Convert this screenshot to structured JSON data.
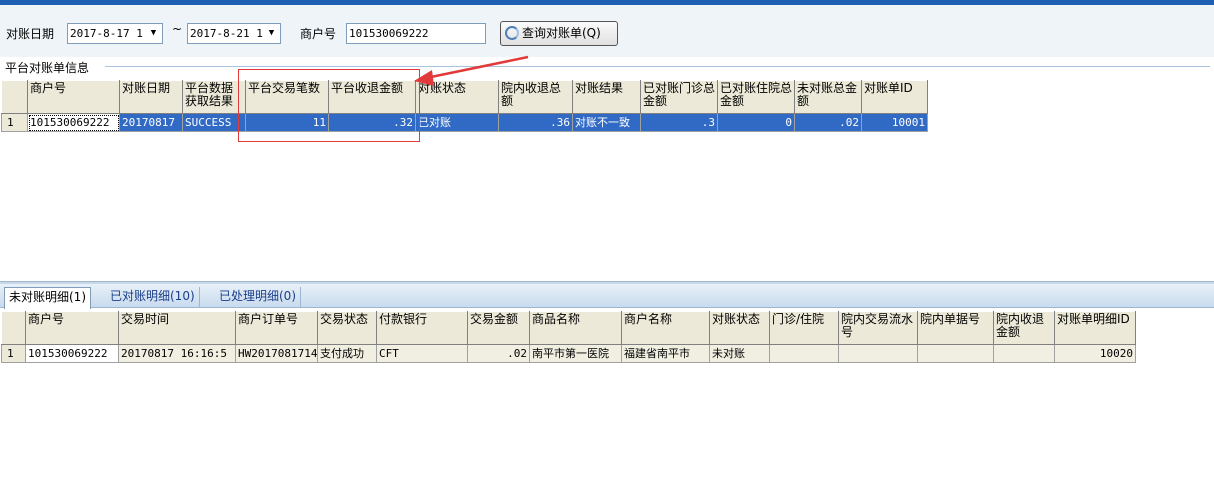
{
  "toolbar": {
    "date_label": "对账日期",
    "date_from": "2017-8-17 1",
    "date_sep": "~",
    "date_to": "2017-8-21 1",
    "merchant_label": "商户号",
    "merchant_value": "101530069222",
    "query_button": "查询对账单(Q)"
  },
  "platform_group": {
    "title": "平台对账单信息",
    "columns": [
      "商户号",
      "对账日期",
      "平台数据获取结果",
      "平台交易笔数",
      "平台收退金额",
      "对账状态",
      "院内收退总额",
      "对账结果",
      "已对账门诊总金额",
      "已对账住院总金额",
      "未对账总金额",
      "对账单ID"
    ],
    "rows": [
      {
        "n": "1",
        "merchant": "101530069222",
        "date": "20170817",
        "fetch_result": "SUCCESS",
        "count": "11",
        "amount": ".32",
        "status": "已对账",
        "hosp_amount": ".36",
        "result": "对账不一致",
        "outpatient": ".3",
        "inpatient": "0",
        "unreconciled": ".02",
        "id": "10001"
      }
    ]
  },
  "tabs": [
    {
      "label": "未对账明细(1)"
    },
    {
      "label": "已对账明细(10)"
    },
    {
      "label": "已处理明细(0)"
    }
  ],
  "detail_group": {
    "columns": [
      "商户号",
      "交易时间",
      "商户订单号",
      "交易状态",
      "付款银行",
      "交易金额",
      "商品名称",
      "商户名称",
      "对账状态",
      "门诊/住院",
      "院内交易流水号",
      "院内单据号",
      "院内收退金额",
      "对账单明细ID"
    ],
    "rows": [
      {
        "n": "1",
        "merchant": "101530069222",
        "time": "20170817 16:16:5",
        "order": "HW20170817141",
        "trade_status": "支付成功",
        "bank": "CFT",
        "amount": ".02",
        "product": "南平市第一医院",
        "merchant_name": "福建省南平市",
        "status": "未对账",
        "type": "",
        "flow_no": "",
        "bill_no": "",
        "hosp_amount": "",
        "id": "10020"
      }
    ]
  },
  "colors": {
    "accent": "#1f5fb4",
    "selection": "#316ac5",
    "annotation": "#e23a3a"
  }
}
